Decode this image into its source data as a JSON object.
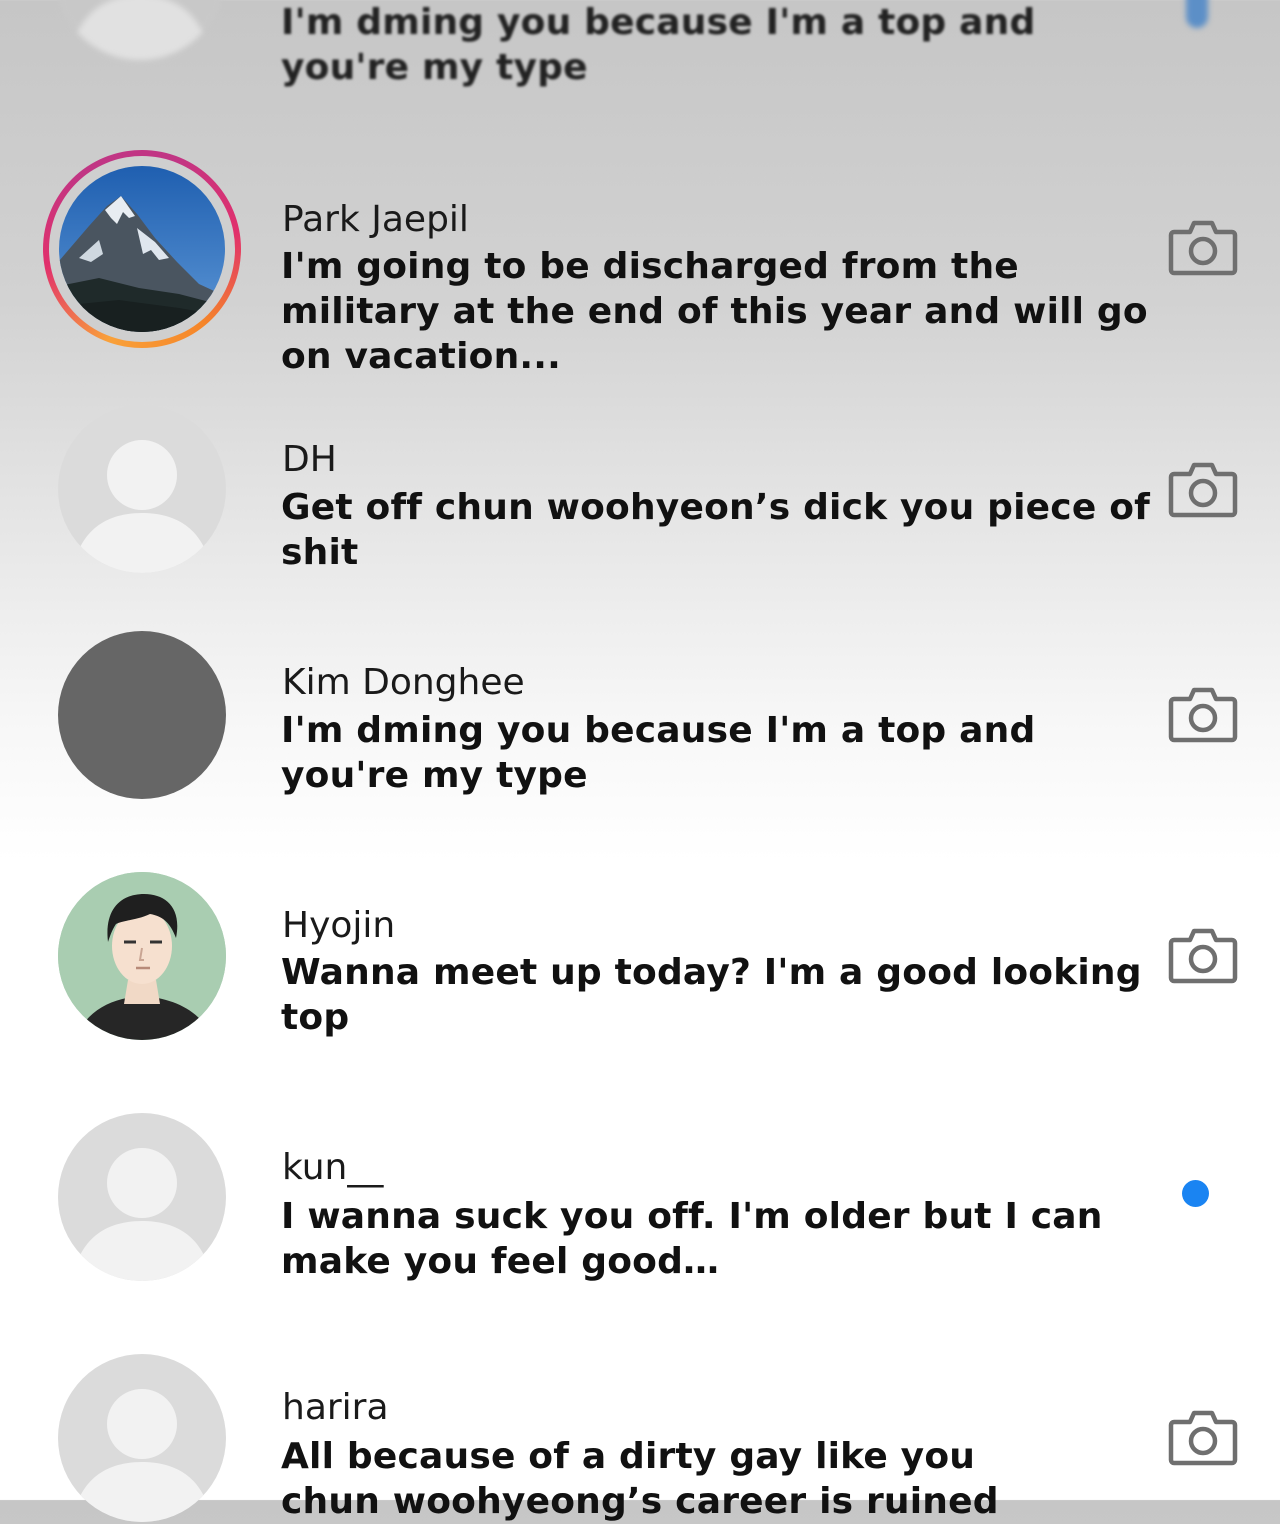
{
  "conversations": [
    {
      "name": "",
      "message": "I'm dming you because I'm a top and you're my type",
      "avatar_type": "default",
      "indicator": "unread-dot",
      "partial": true
    },
    {
      "name": "Park Jaepil",
      "message": "I'm going to be discharged from the military at the end of this year and will go on vacation...",
      "avatar_type": "mountain-photo-with-story-ring",
      "indicator": "camera-icon"
    },
    {
      "name": "DH",
      "message": "Get off chun woohyeon’s dick you piece of shit",
      "avatar_type": "default",
      "indicator": "camera-icon"
    },
    {
      "name": "Kim Donghee",
      "message": "I'm dming you because I'm a top and you're my type",
      "avatar_type": "dark-gray",
      "indicator": "camera-icon"
    },
    {
      "name": "Hyojin",
      "message": "Wanna meet up today? I'm a good looking top",
      "avatar_type": "illustrated-person",
      "indicator": "camera-icon"
    },
    {
      "name": "kun__",
      "message": "I wanna suck you off. I'm older but I can make you feel good…",
      "avatar_type": "default",
      "indicator": "unread-dot"
    },
    {
      "name": "harira",
      "message": "All because of a dirty gay like you chun woohyeong’s career is ruined",
      "avatar_type": "default",
      "indicator": "camera-icon"
    }
  ],
  "colors": {
    "unread_dot": "#1a84f2",
    "story_ring_start": "#f9a13a",
    "story_ring_end": "#c13584",
    "default_avatar_bg": "#dbdbdb",
    "default_avatar_fg": "#f2f2f2",
    "dark_avatar": "#666666",
    "icon_gray": "#6f6f6f"
  }
}
